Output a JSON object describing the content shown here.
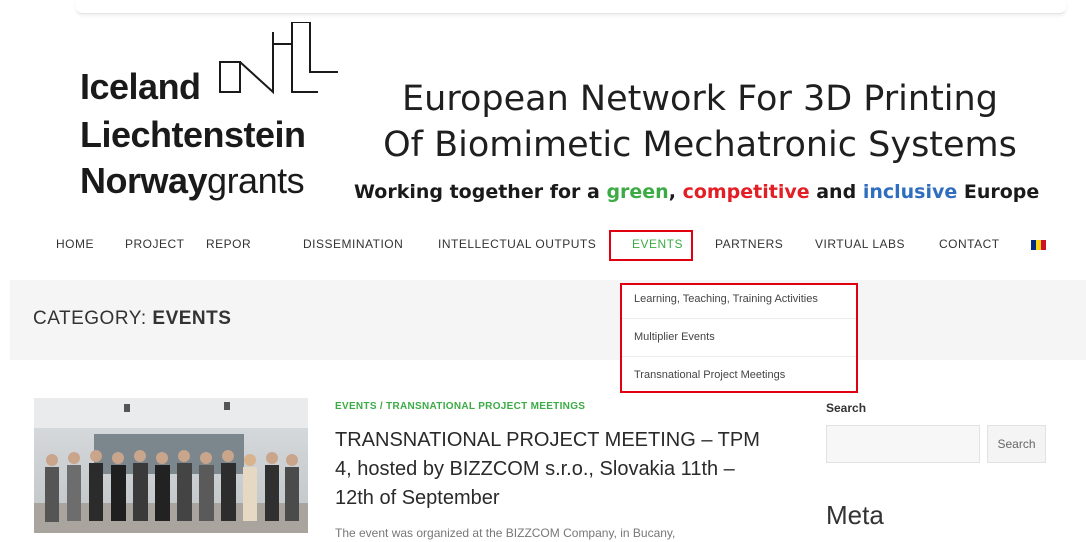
{
  "logo": {
    "line1": "Iceland",
    "line2": "Liechtenstein",
    "line3_bold": "Norway",
    "line3_light": "grants"
  },
  "header": {
    "title_line1": "European Network For 3D Printing",
    "title_line2": "Of Biomimetic Mechatronic Systems",
    "tagline": {
      "part1": "Working together for a ",
      "green": "green",
      "part2": ", ",
      "competitive": "competitive",
      "part3": " and ",
      "inclusive": "inclusive",
      "part4": " Europe"
    },
    "colors": {
      "green": "#3cab45",
      "red": "#e31e24",
      "blue": "#2f6dbf",
      "highlight": "#e0000f"
    }
  },
  "nav": {
    "items": [
      {
        "label": "HOME"
      },
      {
        "label": "PROJECT"
      },
      {
        "label": "REPOR"
      },
      {
        "label": "DISSEMINATION"
      },
      {
        "label": "INTELLECTUAL OUTPUTS"
      },
      {
        "label": "EVENTS",
        "active": true
      },
      {
        "label": "PARTNERS"
      },
      {
        "label": "VIRTUAL LABS"
      },
      {
        "label": "CONTACT"
      }
    ],
    "language_icon": "romania-flag-icon"
  },
  "category": {
    "prefix": "CATEGORY: ",
    "name": "EVENTS"
  },
  "dropdown": {
    "items": [
      {
        "label": "Learning, Teaching, Training Activities"
      },
      {
        "label": "Multiplier Events"
      },
      {
        "label": "Transnational Project Meetings"
      }
    ]
  },
  "post": {
    "meta": "EVENTS / TRANSNATIONAL PROJECT MEETINGS",
    "title": "TRANSNATIONAL PROJECT MEETING – TPM 4, hosted by BIZZCOM s.r.o., Slovakia 11th – 12th of September",
    "excerpt": "The event was organized at the BIZZCOM Company, in Bucany,"
  },
  "sidebar": {
    "search_label": "Search",
    "search_button": "Search",
    "search_value": "",
    "meta_heading": "Meta"
  }
}
